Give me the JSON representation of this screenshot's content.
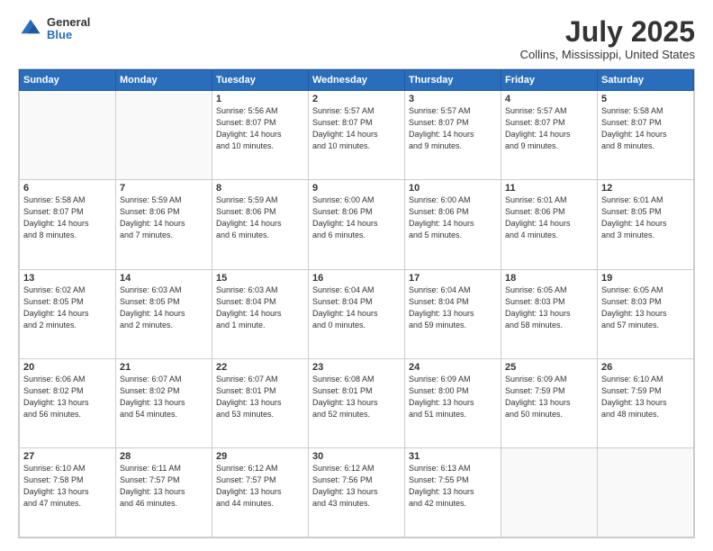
{
  "header": {
    "logo": {
      "general": "General",
      "blue": "Blue"
    },
    "title": "July 2025",
    "subtitle": "Collins, Mississippi, United States"
  },
  "calendar": {
    "days_of_week": [
      "Sunday",
      "Monday",
      "Tuesday",
      "Wednesday",
      "Thursday",
      "Friday",
      "Saturday"
    ],
    "weeks": [
      [
        {
          "day": "",
          "info": ""
        },
        {
          "day": "",
          "info": ""
        },
        {
          "day": "1",
          "info": "Sunrise: 5:56 AM\nSunset: 8:07 PM\nDaylight: 14 hours\nand 10 minutes."
        },
        {
          "day": "2",
          "info": "Sunrise: 5:57 AM\nSunset: 8:07 PM\nDaylight: 14 hours\nand 10 minutes."
        },
        {
          "day": "3",
          "info": "Sunrise: 5:57 AM\nSunset: 8:07 PM\nDaylight: 14 hours\nand 9 minutes."
        },
        {
          "day": "4",
          "info": "Sunrise: 5:57 AM\nSunset: 8:07 PM\nDaylight: 14 hours\nand 9 minutes."
        },
        {
          "day": "5",
          "info": "Sunrise: 5:58 AM\nSunset: 8:07 PM\nDaylight: 14 hours\nand 8 minutes."
        }
      ],
      [
        {
          "day": "6",
          "info": "Sunrise: 5:58 AM\nSunset: 8:07 PM\nDaylight: 14 hours\nand 8 minutes."
        },
        {
          "day": "7",
          "info": "Sunrise: 5:59 AM\nSunset: 8:06 PM\nDaylight: 14 hours\nand 7 minutes."
        },
        {
          "day": "8",
          "info": "Sunrise: 5:59 AM\nSunset: 8:06 PM\nDaylight: 14 hours\nand 6 minutes."
        },
        {
          "day": "9",
          "info": "Sunrise: 6:00 AM\nSunset: 8:06 PM\nDaylight: 14 hours\nand 6 minutes."
        },
        {
          "day": "10",
          "info": "Sunrise: 6:00 AM\nSunset: 8:06 PM\nDaylight: 14 hours\nand 5 minutes."
        },
        {
          "day": "11",
          "info": "Sunrise: 6:01 AM\nSunset: 8:06 PM\nDaylight: 14 hours\nand 4 minutes."
        },
        {
          "day": "12",
          "info": "Sunrise: 6:01 AM\nSunset: 8:05 PM\nDaylight: 14 hours\nand 3 minutes."
        }
      ],
      [
        {
          "day": "13",
          "info": "Sunrise: 6:02 AM\nSunset: 8:05 PM\nDaylight: 14 hours\nand 2 minutes."
        },
        {
          "day": "14",
          "info": "Sunrise: 6:03 AM\nSunset: 8:05 PM\nDaylight: 14 hours\nand 2 minutes."
        },
        {
          "day": "15",
          "info": "Sunrise: 6:03 AM\nSunset: 8:04 PM\nDaylight: 14 hours\nand 1 minute."
        },
        {
          "day": "16",
          "info": "Sunrise: 6:04 AM\nSunset: 8:04 PM\nDaylight: 14 hours\nand 0 minutes."
        },
        {
          "day": "17",
          "info": "Sunrise: 6:04 AM\nSunset: 8:04 PM\nDaylight: 13 hours\nand 59 minutes."
        },
        {
          "day": "18",
          "info": "Sunrise: 6:05 AM\nSunset: 8:03 PM\nDaylight: 13 hours\nand 58 minutes."
        },
        {
          "day": "19",
          "info": "Sunrise: 6:05 AM\nSunset: 8:03 PM\nDaylight: 13 hours\nand 57 minutes."
        }
      ],
      [
        {
          "day": "20",
          "info": "Sunrise: 6:06 AM\nSunset: 8:02 PM\nDaylight: 13 hours\nand 56 minutes."
        },
        {
          "day": "21",
          "info": "Sunrise: 6:07 AM\nSunset: 8:02 PM\nDaylight: 13 hours\nand 54 minutes."
        },
        {
          "day": "22",
          "info": "Sunrise: 6:07 AM\nSunset: 8:01 PM\nDaylight: 13 hours\nand 53 minutes."
        },
        {
          "day": "23",
          "info": "Sunrise: 6:08 AM\nSunset: 8:01 PM\nDaylight: 13 hours\nand 52 minutes."
        },
        {
          "day": "24",
          "info": "Sunrise: 6:09 AM\nSunset: 8:00 PM\nDaylight: 13 hours\nand 51 minutes."
        },
        {
          "day": "25",
          "info": "Sunrise: 6:09 AM\nSunset: 7:59 PM\nDaylight: 13 hours\nand 50 minutes."
        },
        {
          "day": "26",
          "info": "Sunrise: 6:10 AM\nSunset: 7:59 PM\nDaylight: 13 hours\nand 48 minutes."
        }
      ],
      [
        {
          "day": "27",
          "info": "Sunrise: 6:10 AM\nSunset: 7:58 PM\nDaylight: 13 hours\nand 47 minutes."
        },
        {
          "day": "28",
          "info": "Sunrise: 6:11 AM\nSunset: 7:57 PM\nDaylight: 13 hours\nand 46 minutes."
        },
        {
          "day": "29",
          "info": "Sunrise: 6:12 AM\nSunset: 7:57 PM\nDaylight: 13 hours\nand 44 minutes."
        },
        {
          "day": "30",
          "info": "Sunrise: 6:12 AM\nSunset: 7:56 PM\nDaylight: 13 hours\nand 43 minutes."
        },
        {
          "day": "31",
          "info": "Sunrise: 6:13 AM\nSunset: 7:55 PM\nDaylight: 13 hours\nand 42 minutes."
        },
        {
          "day": "",
          "info": ""
        },
        {
          "day": "",
          "info": ""
        }
      ]
    ]
  }
}
